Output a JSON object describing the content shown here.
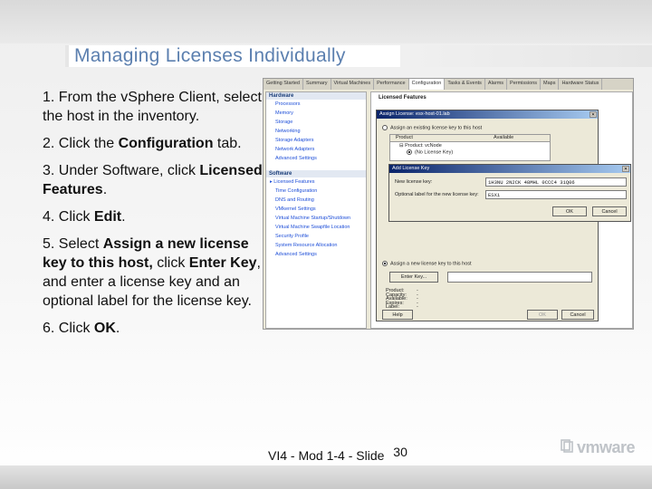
{
  "slide": {
    "title": "Managing Licenses Individually",
    "steps": [
      {
        "num": "1.",
        "parts": [
          {
            "t": "From the v"
          },
          {
            "t": "Sphere Client, select the host in the inventory."
          }
        ]
      },
      {
        "num": "2.",
        "parts": [
          {
            "t": "Click the "
          },
          {
            "t": "Configuration",
            "b": true
          },
          {
            "t": " tab."
          }
        ]
      },
      {
        "num": "3.",
        "parts": [
          {
            "t": "Under Software, click "
          },
          {
            "t": "Licensed Features",
            "b": true
          },
          {
            "t": "."
          }
        ]
      },
      {
        "num": "4.",
        "parts": [
          {
            "t": "Click "
          },
          {
            "t": "Edit",
            "b": true
          },
          {
            "t": "."
          }
        ]
      },
      {
        "num": "5.",
        "parts": [
          {
            "t": "Select "
          },
          {
            "t": "Assign a new license key to this host,",
            "b": true
          },
          {
            "t": " click "
          },
          {
            "t": "Enter Key",
            "b": true
          },
          {
            "t": ", and enter a license key and an optional label for the license key."
          }
        ]
      },
      {
        "num": "6.",
        "parts": [
          {
            "t": "Click "
          },
          {
            "t": "OK",
            "b": true
          },
          {
            "t": "."
          }
        ]
      }
    ],
    "footer": "VI4 - Mod 1-4 - Slide",
    "slide_number": "30",
    "logo": "vmware"
  },
  "screenshot": {
    "tabs": [
      "Getting Started",
      "Summary",
      "Virtual Machines",
      "Performance",
      "Configuration",
      "Tasks & Events",
      "Alarms",
      "Permissions",
      "Maps",
      "Hardware Status"
    ],
    "active_tab": "Configuration",
    "hardware_header": "Hardware",
    "hardware_items": [
      "Processors",
      "Memory",
      "Storage",
      "Networking",
      "Storage Adapters",
      "Network Adapters",
      "Advanced Settings"
    ],
    "software_header": "Software",
    "software_items": [
      "Licensed Features",
      "Time Configuration",
      "DNS and Routing",
      "VMkernel Settings",
      "Virtual Machine Startup/Shutdown",
      "Virtual Machine Swapfile Location",
      "Security Profile",
      "System Resource Allocation",
      "Advanced Settings"
    ],
    "licensed_features_header": "Licensed Features",
    "assign_dialog": {
      "title": "Assign License: esx-host-01.lab",
      "option_existing": "Assign an existing license key to this host",
      "col_product": "Product",
      "col_available": "Available",
      "row_product": "Product: vcNode",
      "row_key": "(No License Key)",
      "option_new": "Assign a new license key to this host",
      "enter_key_button": "Enter Key...",
      "details": [
        {
          "k": "Product:",
          "v": "-"
        },
        {
          "k": "Capacity:",
          "v": "-"
        },
        {
          "k": "Available:",
          "v": "-"
        },
        {
          "k": "Expires:",
          "v": "-"
        },
        {
          "k": "Label:",
          "v": "-"
        }
      ],
      "help_button": "Help",
      "ok_button": "OK",
      "cancel_button": "Cancel"
    },
    "add_key_dialog": {
      "title": "Add License Key",
      "key_label": "New license key:",
      "key_value": "1H3NU 2N2CK 48MHL 0CCC4 31Q06",
      "label_label": "Optional label for the new license key:",
      "label_value": "ESXi",
      "ok_button": "OK",
      "cancel_button": "Cancel"
    }
  }
}
